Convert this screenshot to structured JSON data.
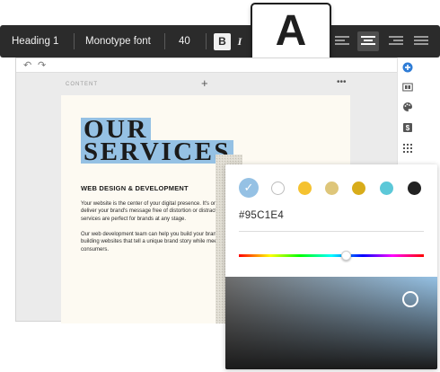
{
  "toolbar": {
    "heading": "Heading 1",
    "font": "Monotype font",
    "size": "40",
    "bold": "B",
    "italic": "I"
  },
  "text_color_preview": {
    "letter": "A",
    "color": "#95C1E4"
  },
  "editor": {
    "section_label": "CONTENT",
    "plus": "+",
    "more": "•••",
    "undo": "↶",
    "redo": "↷"
  },
  "document": {
    "title_line1": "OUR",
    "title_line2": "SERVICES",
    "highlight_color": "#95C1E4",
    "subheading": "WEB DESIGN & DEVELOPMENT",
    "paragraph1": [
      "Your website is the center of your digital presence. It's one",
      "deliver your brand's message free of distortion or distractio",
      "services are perfect for brands at any stage."
    ],
    "paragraph2": [
      "Our web development team can help you build your brand's",
      "building websites that tell a unique brand story while meeti",
      "consumers."
    ]
  },
  "color_picker": {
    "hex_value": "#95C1E4",
    "hue_position": 0.58,
    "swatches": [
      {
        "name": "light-blue",
        "color": "#95C1E4",
        "selected": true
      },
      {
        "name": "white",
        "color": "#FFFFFF",
        "selected": false
      },
      {
        "name": "yellow",
        "color": "#F5C230",
        "selected": false
      },
      {
        "name": "khaki",
        "color": "#DEC67A",
        "selected": false
      },
      {
        "name": "gold",
        "color": "#D8AC1A",
        "selected": false
      },
      {
        "name": "cyan",
        "color": "#5CC8D8",
        "selected": false
      },
      {
        "name": "black",
        "color": "#222222",
        "selected": false
      }
    ]
  },
  "sidebar": {
    "icons": [
      "add-icon",
      "embed-icon",
      "palette-icon",
      "dollar-icon",
      "grid-icon"
    ],
    "accent": "#2E7CD6"
  }
}
